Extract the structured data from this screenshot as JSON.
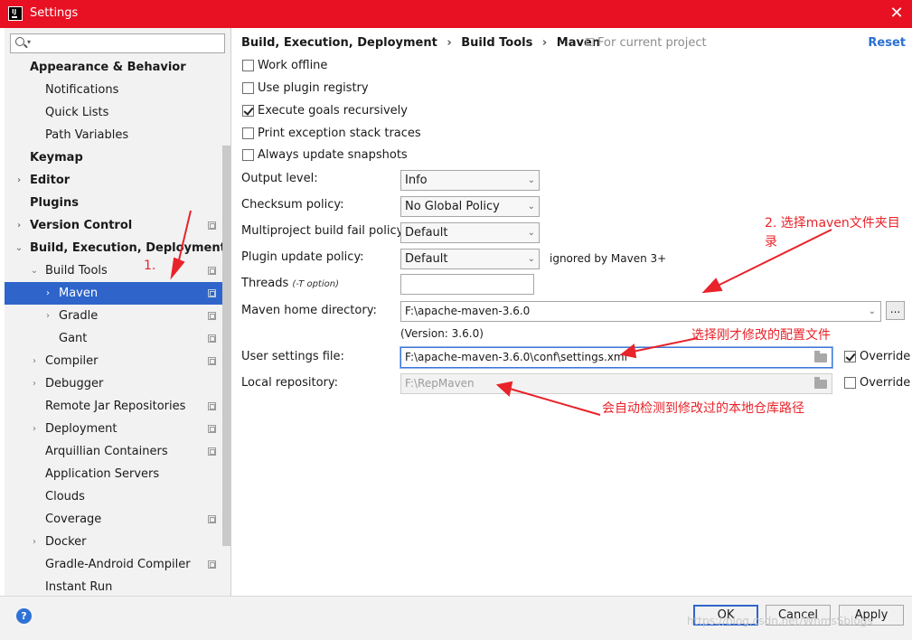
{
  "window": {
    "title": "Settings",
    "close_glyph": "✕",
    "app_icon_text": "IJ"
  },
  "sidebar": {
    "search_placeholder": "",
    "items": [
      {
        "label": "Appearance & Behavior",
        "bold": true,
        "arrow": "",
        "proj": false
      },
      {
        "label": "Notifications",
        "bold": false,
        "arrow": "",
        "proj": false
      },
      {
        "label": "Quick Lists",
        "bold": false,
        "arrow": "",
        "proj": false
      },
      {
        "label": "Path Variables",
        "bold": false,
        "arrow": "",
        "proj": false
      },
      {
        "label": "Keymap",
        "bold": true,
        "arrow": "",
        "proj": false
      },
      {
        "label": "Editor",
        "bold": true,
        "arrow": "›",
        "proj": false
      },
      {
        "label": "Plugins",
        "bold": true,
        "arrow": "",
        "proj": false
      },
      {
        "label": "Version Control",
        "bold": true,
        "arrow": "›",
        "proj": true
      },
      {
        "label": "Build, Execution, Deployment",
        "bold": true,
        "arrow": "⌄",
        "proj": false
      },
      {
        "label": "Build Tools",
        "bold": false,
        "arrow": "⌄",
        "proj": true
      },
      {
        "label": "Maven",
        "bold": false,
        "arrow": "›",
        "proj": true,
        "selected": true
      },
      {
        "label": "Gradle",
        "bold": false,
        "arrow": "›",
        "proj": true
      },
      {
        "label": "Gant",
        "bold": false,
        "arrow": "",
        "proj": true
      },
      {
        "label": "Compiler",
        "bold": false,
        "arrow": "›",
        "proj": true
      },
      {
        "label": "Debugger",
        "bold": false,
        "arrow": "›",
        "proj": false
      },
      {
        "label": "Remote Jar Repositories",
        "bold": false,
        "arrow": "",
        "proj": true
      },
      {
        "label": "Deployment",
        "bold": false,
        "arrow": "›",
        "proj": true
      },
      {
        "label": "Arquillian Containers",
        "bold": false,
        "arrow": "",
        "proj": true
      },
      {
        "label": "Application Servers",
        "bold": false,
        "arrow": "",
        "proj": false
      },
      {
        "label": "Clouds",
        "bold": false,
        "arrow": "",
        "proj": false
      },
      {
        "label": "Coverage",
        "bold": false,
        "arrow": "",
        "proj": true
      },
      {
        "label": "Docker",
        "bold": false,
        "arrow": "›",
        "proj": false
      },
      {
        "label": "Gradle-Android Compiler",
        "bold": false,
        "arrow": "",
        "proj": true
      },
      {
        "label": "Instant Run",
        "bold": false,
        "arrow": "",
        "proj": false
      }
    ]
  },
  "breadcrumb": [
    "Build, Execution, Deployment",
    "Build Tools",
    "Maven"
  ],
  "breadcrumb_sep": "›",
  "for_current_project": "For current project",
  "reset_label": "Reset",
  "checkboxes": [
    {
      "label": "Work offline",
      "checked": false
    },
    {
      "label": "Use plugin registry",
      "checked": false
    },
    {
      "label": "Execute goals recursively",
      "checked": true
    },
    {
      "label": "Print exception stack traces",
      "checked": false
    },
    {
      "label": "Always update snapshots",
      "checked": false
    }
  ],
  "fields": {
    "output_level": {
      "label": "Output level:",
      "value": "Info"
    },
    "checksum_policy": {
      "label": "Checksum policy:",
      "value": "No Global Policy"
    },
    "multiproject_fail": {
      "label": "Multiproject build fail policy:",
      "value": "Default"
    },
    "plugin_update": {
      "label": "Plugin update policy:",
      "value": "Default",
      "note": "ignored by Maven 3+"
    },
    "threads": {
      "label": "Threads",
      "hint": "(-T option)",
      "value": ""
    },
    "maven_home": {
      "label": "Maven home directory:",
      "value": "F:\\apache-maven-3.6.0",
      "browse": "..."
    },
    "version": "(Version: 3.6.0)",
    "user_settings": {
      "label": "User settings file:",
      "value": "F:\\apache-maven-3.6.0\\conf\\settings.xml",
      "override_label": "Override",
      "override": true
    },
    "local_repo": {
      "label": "Local repository:",
      "value": "F:\\RepMaven",
      "override_label": "Override",
      "override": false
    }
  },
  "annotations": {
    "step1": "1.",
    "step2_line1": "2. 选择maven文件夹目",
    "step2_line2": "录",
    "settings_note": "选择刚才修改的配置文件",
    "repo_note": "会自动检测到修改过的本地仓库路径"
  },
  "footer": {
    "help": "?",
    "ok": "OK",
    "cancel": "Cancel",
    "apply": "Apply",
    "watermark": "https://blog.csdn.net/WhmsSblogs"
  },
  "colors": {
    "accent": "#2f65ca",
    "titlebar": "#e81123",
    "annotation": "#e8232a",
    "link": "#2a6fd1"
  }
}
